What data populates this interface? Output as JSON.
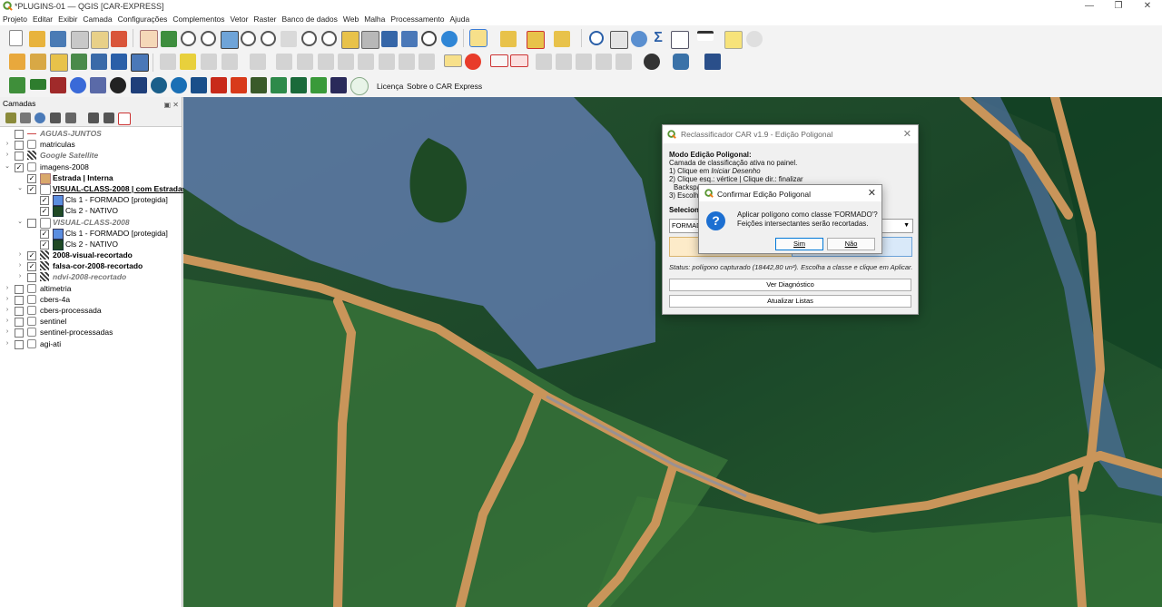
{
  "window": {
    "title": "*PLUGINS-01 — QGIS [CAR-EXPRESS]",
    "controls": [
      "—",
      "❐",
      "✕"
    ]
  },
  "menu": [
    "Projeto",
    "Editar",
    "Exibir",
    "Camada",
    "Configurações",
    "Complementos",
    "Vetor",
    "Raster",
    "Banco de dados",
    "Web",
    "Malha",
    "Processamento",
    "Ajuda"
  ],
  "toolbar3_text": {
    "license": "Licença",
    "about": "Sobre o CAR Express"
  },
  "layers_panel": {
    "title": "Camadas",
    "items": [
      {
        "label": "AGUAS-JUNTOS",
        "style": "italic",
        "checked": false,
        "expander": "",
        "indent": 0,
        "icon": "line"
      },
      {
        "label": "matriculas",
        "style": "normal",
        "checked": false,
        "expander": "›",
        "indent": 0,
        "icon": "group"
      },
      {
        "label": "Google Satellite",
        "style": "italic",
        "checked": false,
        "expander": "›",
        "indent": 0,
        "icon": "raster"
      },
      {
        "label": "imagens-2008",
        "style": "normal",
        "checked": true,
        "expander": "⌄",
        "indent": 0,
        "icon": "group"
      },
      {
        "label": "Estrada | Interna",
        "style": "bold",
        "checked": true,
        "expander": "",
        "indent": 1,
        "icon": "tan"
      },
      {
        "label": "VISUAL-CLASS-2008 | com Estradas",
        "style": "underline",
        "checked": true,
        "expander": "⌄",
        "indent": 1,
        "icon": "poly"
      },
      {
        "label": "Cls 1 - FORMADO [protegida]",
        "style": "normal",
        "checked": true,
        "expander": "",
        "indent": 2,
        "icon": "blue"
      },
      {
        "label": "Cls 2 - NATIVO",
        "style": "normal",
        "checked": true,
        "expander": "",
        "indent": 2,
        "icon": "green"
      },
      {
        "label": "VISUAL-CLASS-2008",
        "style": "italic",
        "checked": false,
        "expander": "⌄",
        "indent": 1,
        "icon": "poly"
      },
      {
        "label": "Cls 1 - FORMADO [protegida]",
        "style": "normal",
        "checked": true,
        "expander": "",
        "indent": 2,
        "icon": "blue"
      },
      {
        "label": "Cls 2 - NATIVO",
        "style": "normal",
        "checked": true,
        "expander": "",
        "indent": 2,
        "icon": "green"
      },
      {
        "label": "2008-visual-recortado",
        "style": "bold",
        "checked": true,
        "expander": "›",
        "indent": 1,
        "icon": "raster"
      },
      {
        "label": "falsa-cor-2008-recortado",
        "style": "bold",
        "checked": true,
        "expander": "›",
        "indent": 1,
        "icon": "raster"
      },
      {
        "label": "ndvi-2008-recortado",
        "style": "italic",
        "checked": false,
        "expander": "›",
        "indent": 1,
        "icon": "raster"
      },
      {
        "label": "altimetria",
        "style": "normal",
        "checked": false,
        "expander": "›",
        "indent": 0,
        "icon": "group"
      },
      {
        "label": "cbers-4a",
        "style": "normal",
        "checked": false,
        "expander": "›",
        "indent": 0,
        "icon": "group"
      },
      {
        "label": "cbers-processada",
        "style": "normal",
        "checked": false,
        "expander": "›",
        "indent": 0,
        "icon": "group"
      },
      {
        "label": "sentinel",
        "style": "normal",
        "checked": false,
        "expander": "›",
        "indent": 0,
        "icon": "group"
      },
      {
        "label": "sentinel-processadas",
        "style": "normal",
        "checked": false,
        "expander": "›",
        "indent": 0,
        "icon": "group"
      },
      {
        "label": "agi-ati",
        "style": "normal",
        "checked": false,
        "expander": "›",
        "indent": 0,
        "icon": "group"
      }
    ]
  },
  "plugin_dialog": {
    "title": "Reclassificador CAR v1.9 - Edição Poligonal",
    "heading": "Modo Edição Poligonal:",
    "lines": [
      "Camada de classificação ativa no painel.",
      "1) Clique em ",
      "Iniciar Desenho",
      "2) Clique esq.: vértice | Clique dir.: finalizar",
      "Backspa",
      "3) Escolha"
    ],
    "select_label": "Selecion",
    "combo_value": "FORMADO",
    "status": "Status: polígono capturado (18442,80 un²). Escolha a classe e clique em Aplicar.",
    "btn_diag": "Ver Diagnóstico",
    "btn_refresh": "Atualizar Listas"
  },
  "confirm_dialog": {
    "title": "Confirmar Edição Poligonal",
    "message_line1": "Aplicar polígono como classe 'FORMADO'?",
    "message_line2": "Feições intersectantes serão recortadas.",
    "yes": "Sim",
    "no": "Não",
    "close": "✕"
  }
}
